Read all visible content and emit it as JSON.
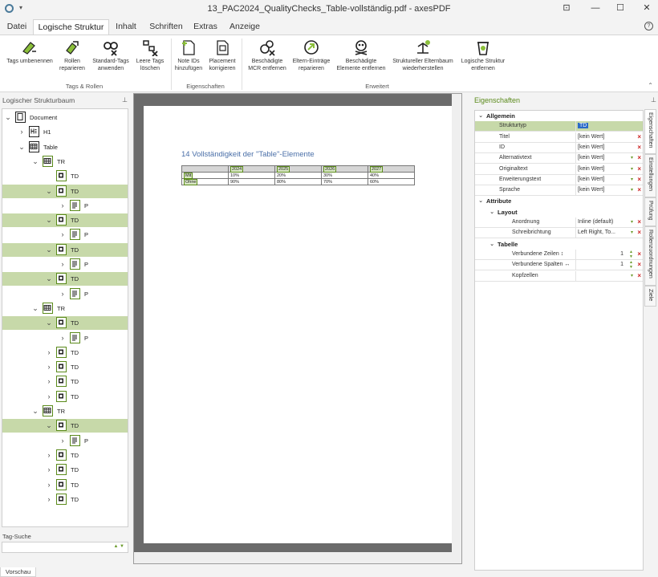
{
  "window": {
    "title": "13_PAC2024_QualityChecks_Table-vollständig.pdf - axesPDF",
    "controls": {
      "pin": "⊡",
      "minimize": "—",
      "maximize": "☐",
      "close": "✕"
    }
  },
  "menu": {
    "tabs": [
      "Datei",
      "Logische Struktur",
      "Inhalt",
      "Schriften",
      "Extras",
      "Anzeige"
    ],
    "active": "Logische Struktur",
    "help": "?"
  },
  "ribbon": {
    "buttons": {
      "tags_umbenennen": [
        "Tags umbenennen",
        ""
      ],
      "rollen_reparieren": [
        "Rollen",
        "reparieren"
      ],
      "standard_tags": [
        "Standard-Tags",
        "anwenden"
      ],
      "leere_tags": [
        "Leere Tags",
        "löschen"
      ],
      "note_ids": [
        "Note IDs",
        "hinzufügen"
      ],
      "placement": [
        "Placement",
        "korrigieren"
      ],
      "mcr_entfernen": [
        "Beschädigte",
        "MCR entfernen"
      ],
      "eltern_eintraege": [
        "Eltern-Einträge",
        "reparieren"
      ],
      "elemente_entfernen": [
        "Beschädigte",
        "Elemente entfernen"
      ],
      "elternbaum": [
        "Struktureller Elternbaum",
        "wiederherstellen"
      ],
      "struktur_entfernen": [
        "Logische Struktur",
        "entfernen"
      ]
    },
    "groups": {
      "tags_rollen": "Tags & Rollen",
      "eigenschaften": "Eigenschaften",
      "erweitert": "Erweitert"
    }
  },
  "left_panel": {
    "title": "Logischer Strukturbaum",
    "tree": [
      {
        "label": "Document",
        "level": 0,
        "chev": "v",
        "icon": "doc",
        "sel": false
      },
      {
        "label": "H1",
        "level": 1,
        "chev": ">",
        "icon": "h",
        "sel": false
      },
      {
        "label": "Table",
        "level": 1,
        "chev": "v",
        "icon": "table",
        "sel": false
      },
      {
        "label": "TR",
        "level": 2,
        "chev": "v",
        "icon": "tr",
        "sel": false
      },
      {
        "label": "TD",
        "level": 3,
        "chev": "",
        "icon": "td",
        "sel": false
      },
      {
        "label": "TD",
        "level": 3,
        "chev": "v",
        "icon": "td",
        "sel": true
      },
      {
        "label": "P",
        "level": 4,
        "chev": ">",
        "icon": "p",
        "sel": false
      },
      {
        "label": "TD",
        "level": 3,
        "chev": "v",
        "icon": "td",
        "sel": true
      },
      {
        "label": "P",
        "level": 4,
        "chev": ">",
        "icon": "p",
        "sel": false
      },
      {
        "label": "TD",
        "level": 3,
        "chev": "v",
        "icon": "td",
        "sel": true
      },
      {
        "label": "P",
        "level": 4,
        "chev": ">",
        "icon": "p",
        "sel": false
      },
      {
        "label": "TD",
        "level": 3,
        "chev": "v",
        "icon": "td",
        "sel": true
      },
      {
        "label": "P",
        "level": 4,
        "chev": ">",
        "icon": "p",
        "sel": false
      },
      {
        "label": "TR",
        "level": 2,
        "chev": "v",
        "icon": "tr",
        "sel": false
      },
      {
        "label": "TD",
        "level": 3,
        "chev": "v",
        "icon": "td",
        "sel": true
      },
      {
        "label": "P",
        "level": 4,
        "chev": ">",
        "icon": "p",
        "sel": false
      },
      {
        "label": "TD",
        "level": 3,
        "chev": ">",
        "icon": "td",
        "sel": false
      },
      {
        "label": "TD",
        "level": 3,
        "chev": ">",
        "icon": "td",
        "sel": false
      },
      {
        "label": "TD",
        "level": 3,
        "chev": ">",
        "icon": "td",
        "sel": false
      },
      {
        "label": "TD",
        "level": 3,
        "chev": ">",
        "icon": "td",
        "sel": false
      },
      {
        "label": "TR",
        "level": 2,
        "chev": "v",
        "icon": "tr",
        "sel": false
      },
      {
        "label": "TD",
        "level": 3,
        "chev": "v",
        "icon": "td",
        "sel": true
      },
      {
        "label": "P",
        "level": 4,
        "chev": ">",
        "icon": "p",
        "sel": false
      },
      {
        "label": "TD",
        "level": 3,
        "chev": ">",
        "icon": "td",
        "sel": false
      },
      {
        "label": "TD",
        "level": 3,
        "chev": ">",
        "icon": "td",
        "sel": false
      },
      {
        "label": "TD",
        "level": 3,
        "chev": ">",
        "icon": "td",
        "sel": false
      },
      {
        "label": "TD",
        "level": 3,
        "chev": ">",
        "icon": "td",
        "sel": false
      }
    ],
    "tag_search_label": "Tag-Suche",
    "tag_search_value": ""
  },
  "bottom_tab": "Vorschau",
  "pdf": {
    "heading": "14 Vollständigkeit der \"Table\"-Elemente",
    "table": {
      "header": [
        "",
        "2024",
        "2025",
        "2026",
        "2027"
      ],
      "rows": [
        [
          "Mit",
          "10%",
          "20%",
          "30%",
          "40%"
        ],
        [
          "Ohne",
          "90%",
          "80%",
          "70%",
          "60%"
        ]
      ]
    }
  },
  "right_panel": {
    "title": "Eigenschaften",
    "sections": {
      "allgemein": "Allgemein",
      "attribute": "Attribute",
      "layout": "Layout",
      "tabelle": "Tabelle"
    },
    "allgemein": [
      {
        "key": "Strukturtyp",
        "value": "TD",
        "controls": ""
      },
      {
        "key": "Titel",
        "value": "[kein Wert]",
        "controls": "x"
      },
      {
        "key": "ID",
        "value": "[kein Wert]",
        "controls": "x"
      },
      {
        "key": "Alternativtext",
        "value": "[kein Wert]",
        "controls": "dx"
      },
      {
        "key": "Originaltext",
        "value": "[kein Wert]",
        "controls": "dx"
      },
      {
        "key": "Erweiterungstext",
        "value": "[kein Wert]",
        "controls": "dx"
      },
      {
        "key": "Sprache",
        "value": "[kein Wert]",
        "controls": "dx"
      }
    ],
    "layout": [
      {
        "key": "Anordnung",
        "value": "Inline (default)",
        "controls": "dx"
      },
      {
        "key": "Schreibrichtung",
        "value": "Left Right, To...",
        "controls": "dx"
      }
    ],
    "tabelle": [
      {
        "key": "Verbundene Zeilen ↕",
        "value": "1",
        "controls": "sx"
      },
      {
        "key": "Verbundene Spalten ↔",
        "value": "1",
        "controls": "sx"
      },
      {
        "key": "Kopfzellen",
        "value": "",
        "controls": "dx"
      }
    ],
    "side_tabs": [
      "Eigenschaften",
      "Einstellungen",
      "Prüfung",
      "Rollenzuordnungen",
      "Ziele"
    ]
  }
}
